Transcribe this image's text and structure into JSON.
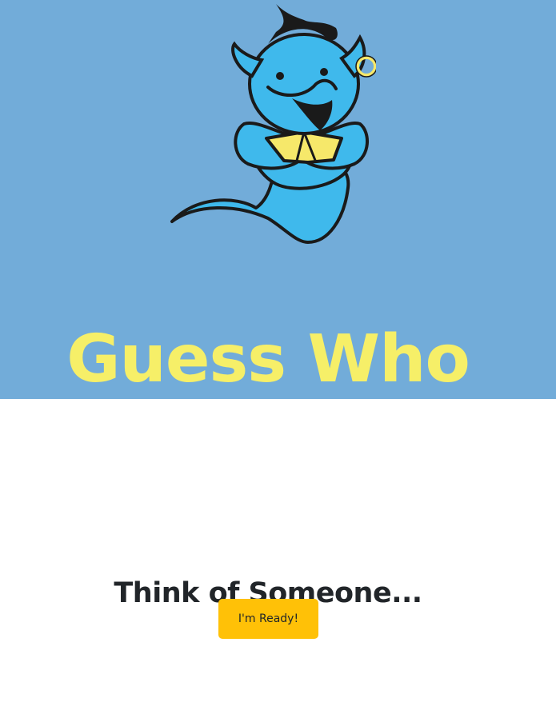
{
  "hero": {
    "title": "Guess Who",
    "logo_icon": "genie-mascot-icon",
    "background_color": "#72acd9",
    "title_color": "#f6ef68"
  },
  "main": {
    "prompt": "Think of Someone...",
    "ready_button_label": "I'm Ready!",
    "button_color": "#ffc107"
  }
}
